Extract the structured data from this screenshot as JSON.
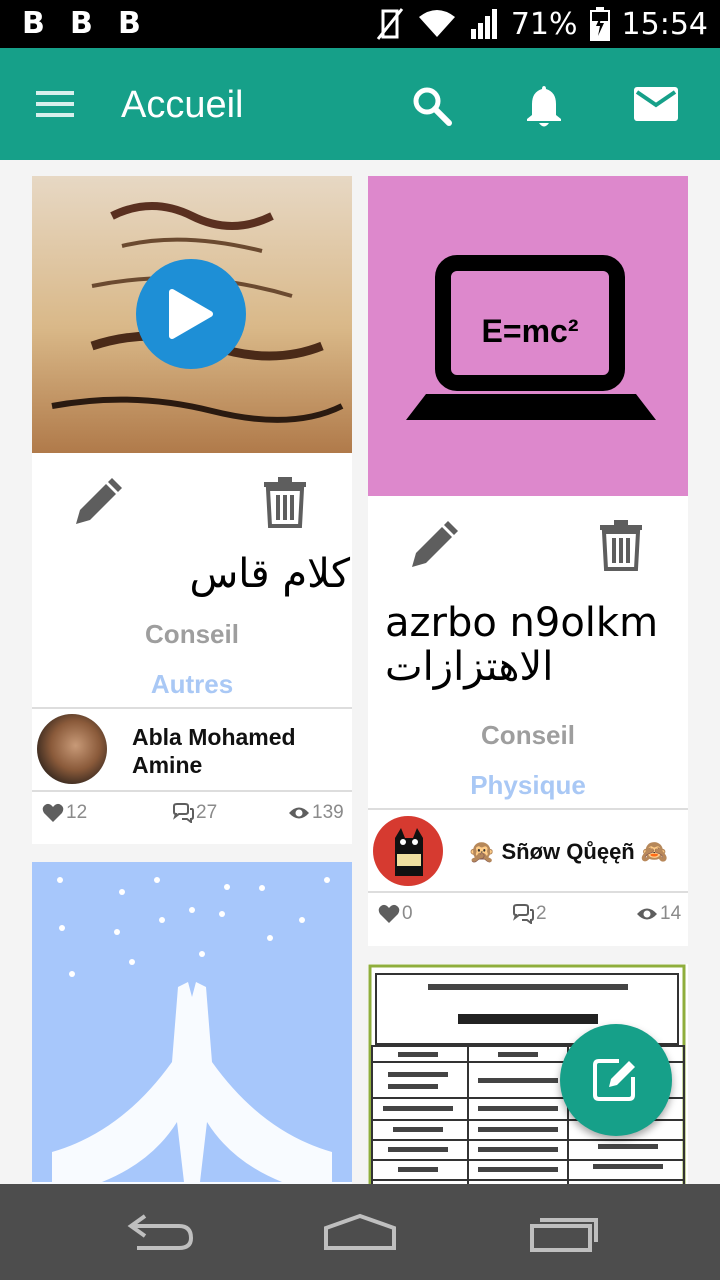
{
  "status_bar": {
    "notif_icons": [
      "B",
      "B",
      "B"
    ],
    "battery": "71%",
    "time": "15:54"
  },
  "app_bar": {
    "title": "Accueil",
    "color": "#16a089"
  },
  "cards": [
    {
      "title": "كلام قاس",
      "type": "Conseil",
      "category": "Autres",
      "author": "Abla Mohamed Amine",
      "likes": "12",
      "comments": "27",
      "views": "139",
      "media": "video"
    },
    {
      "image_text": "E=mc²",
      "title": "azrbo n9olkm الاهتزازات",
      "type": "Conseil",
      "category": "Physique",
      "author": "🙊 Sñøw Qůęęñ 🙈",
      "likes": "0",
      "comments": "2",
      "views": "14"
    }
  ],
  "colors": {
    "accent": "#16a089",
    "category": "#a9c8f5",
    "type": "#9e9e9e",
    "pink_tile": "#dd88cc",
    "blue_tile": "#a7c7fb",
    "play": "#1e8fd6"
  }
}
